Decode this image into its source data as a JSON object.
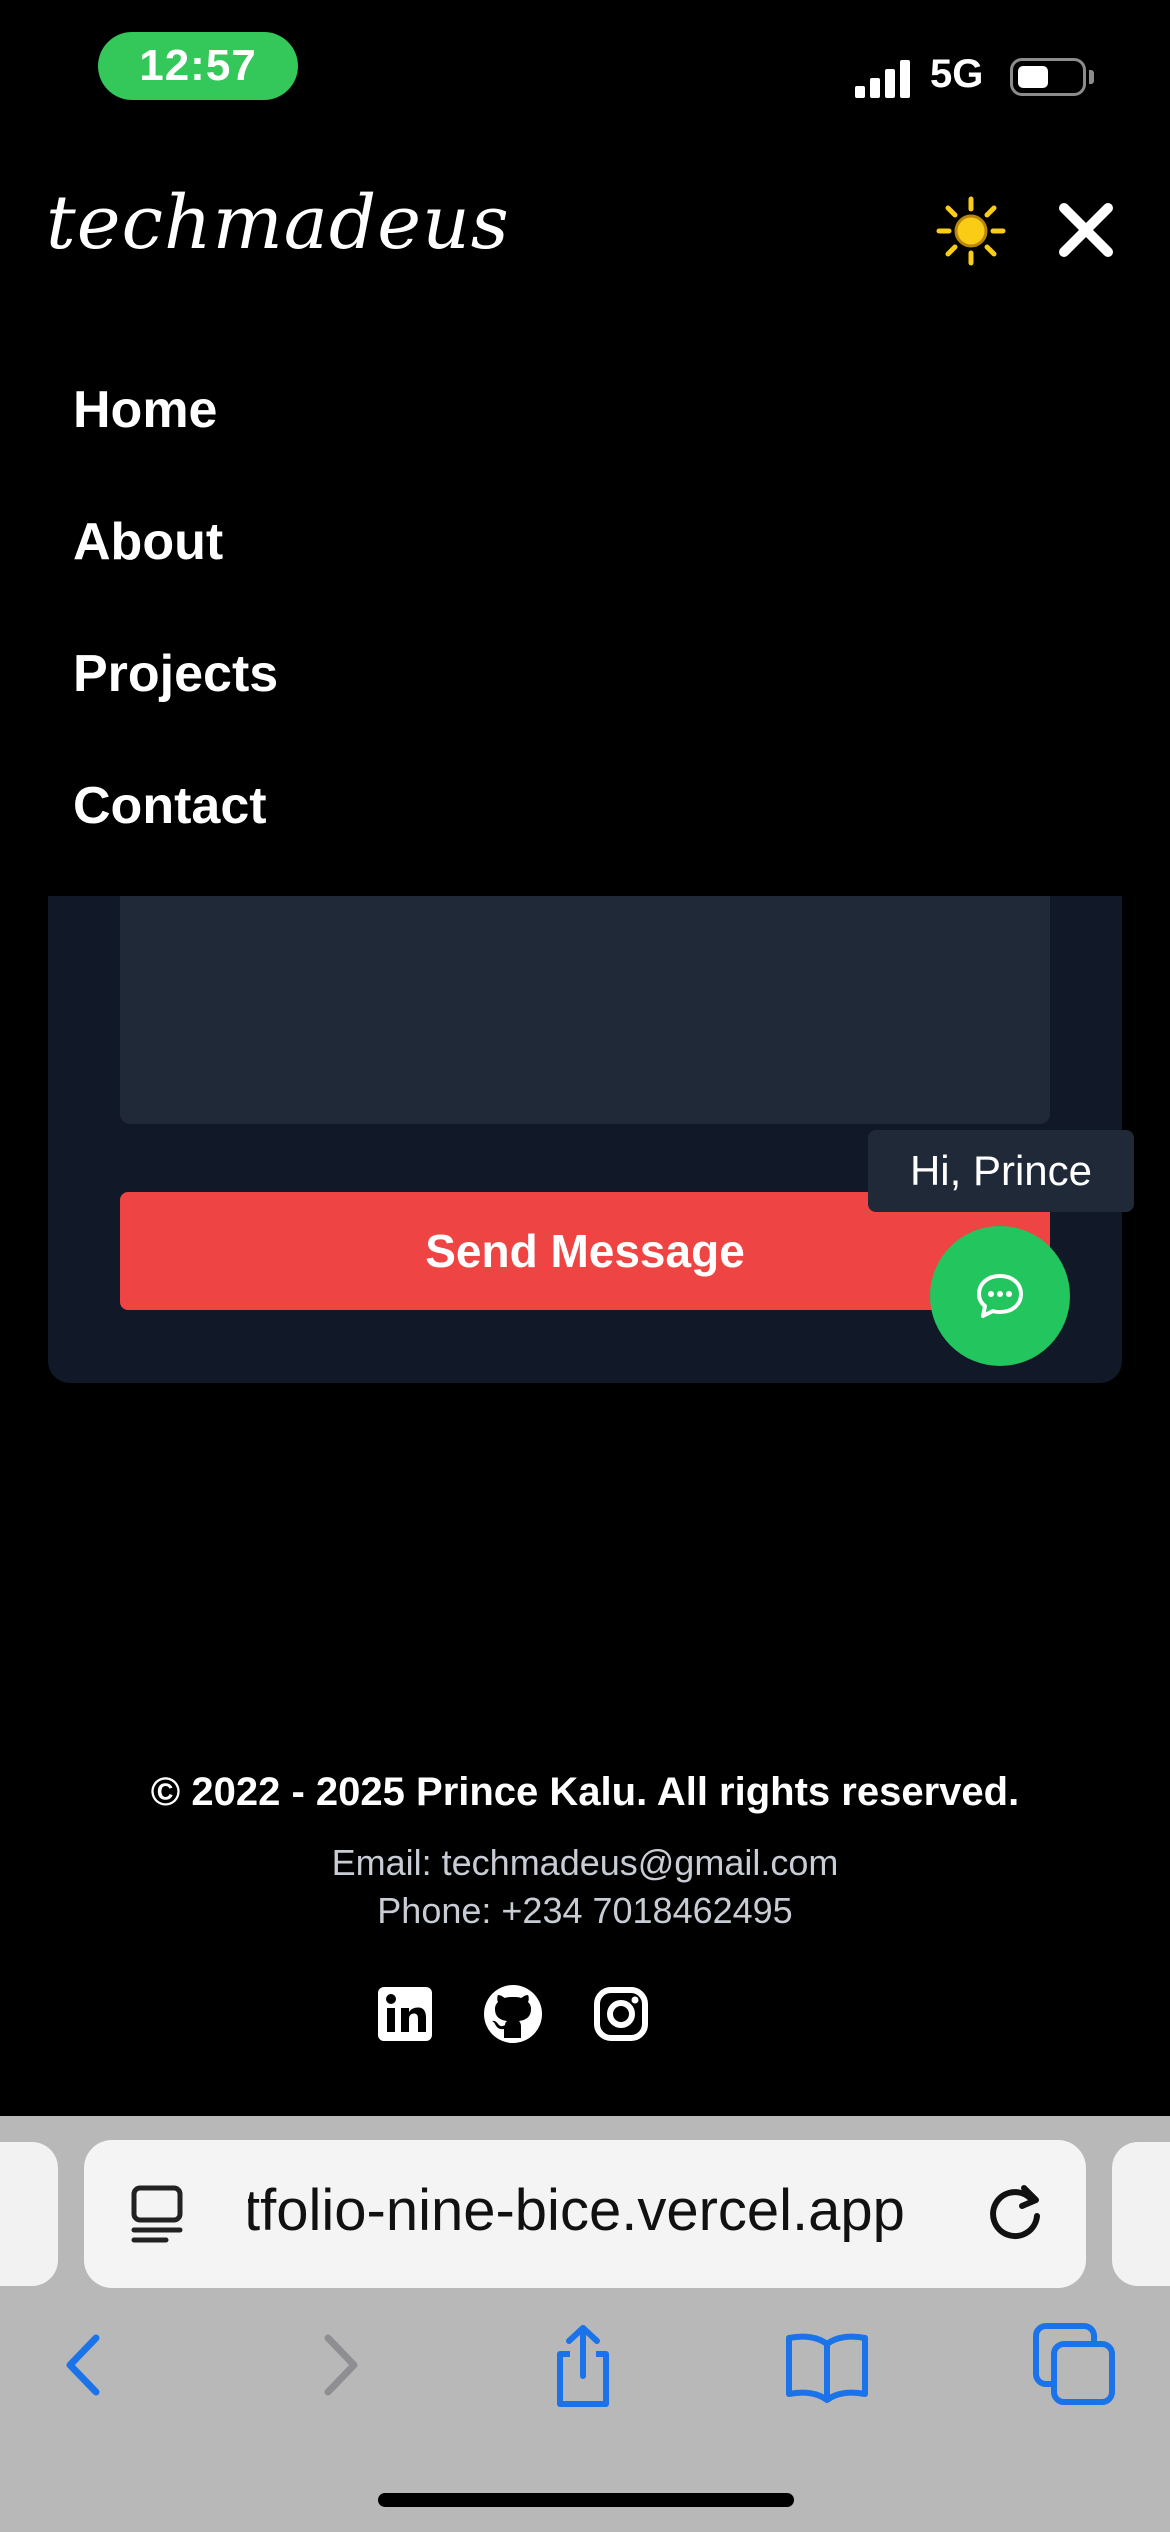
{
  "status_bar": {
    "time": "12:57",
    "network": "5G",
    "battery_level": 0.5
  },
  "header": {
    "logo": "techmadeus",
    "theme_icon": "sun-icon",
    "close_icon": "close-icon"
  },
  "nav": {
    "items": [
      {
        "label": "Home"
      },
      {
        "label": "About"
      },
      {
        "label": "Projects"
      },
      {
        "label": "Contact"
      }
    ]
  },
  "form": {
    "message_value": "",
    "send_label": "Send Message"
  },
  "chat": {
    "tooltip": "Hi, Prince",
    "icon": "chat-bubble-icon"
  },
  "footer": {
    "copyright": "© 2022 - 2025 Prince Kalu. All rights reserved.",
    "email": "Email: techmadeus@gmail.com",
    "phone": "Phone: +234 7018462495",
    "social": [
      "linkedin-icon",
      "github-icon",
      "instagram-icon"
    ]
  },
  "browser": {
    "url": "tfolio-nine-bice.vercel.app",
    "toolbar": [
      "back-icon",
      "forward-icon",
      "share-icon",
      "bookmarks-icon",
      "tabs-icon"
    ]
  },
  "colors": {
    "background": "#000000",
    "card": "#111827",
    "input": "#1f2937",
    "accent_red": "#ef4444",
    "accent_green": "#22c55e",
    "sun_yellow": "#facc15",
    "ios_blue": "#1a73e8"
  }
}
